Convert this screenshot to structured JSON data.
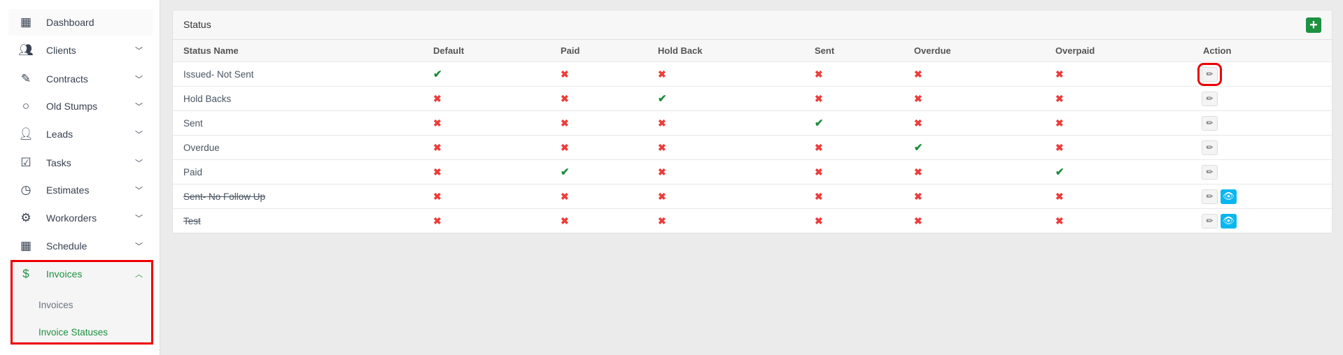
{
  "sidebar": {
    "items": [
      {
        "label": "Dashboard",
        "icon": "grid-icon",
        "chev": false
      },
      {
        "label": "Clients",
        "icon": "users-icon",
        "chev": true
      },
      {
        "label": "Contracts",
        "icon": "pen-icon",
        "chev": true
      },
      {
        "label": "Old Stumps",
        "icon": "circle-icon",
        "chev": true
      },
      {
        "label": "Leads",
        "icon": "user-plus-icon",
        "chev": true
      },
      {
        "label": "Tasks",
        "icon": "checkbox-icon",
        "chev": true
      },
      {
        "label": "Estimates",
        "icon": "clock-icon",
        "chev": true
      },
      {
        "label": "Workorders",
        "icon": "gear-icon",
        "chev": true
      },
      {
        "label": "Schedule",
        "icon": "calendar-icon",
        "chev": true
      },
      {
        "label": "Invoices",
        "icon": "dollar-icon",
        "chev": true
      }
    ],
    "sub_items": [
      "Invoices",
      "Invoice Statuses"
    ]
  },
  "card": {
    "title": "Status",
    "columns": [
      "Status Name",
      "Default",
      "Paid",
      "Hold Back",
      "Sent",
      "Overdue",
      "Overpaid",
      "Action"
    ],
    "rows": [
      {
        "name": "Issued- Not Sent",
        "flags": [
          1,
          0,
          0,
          0,
          0,
          0
        ],
        "deleted": false,
        "eye": false
      },
      {
        "name": "Hold Backs",
        "flags": [
          0,
          0,
          1,
          0,
          0,
          0
        ],
        "deleted": false,
        "eye": false
      },
      {
        "name": "Sent",
        "flags": [
          0,
          0,
          0,
          1,
          0,
          0
        ],
        "deleted": false,
        "eye": false
      },
      {
        "name": "Overdue",
        "flags": [
          0,
          0,
          0,
          0,
          1,
          0
        ],
        "deleted": false,
        "eye": false
      },
      {
        "name": "Paid",
        "flags": [
          0,
          1,
          0,
          0,
          0,
          1
        ],
        "deleted": false,
        "eye": false
      },
      {
        "name": "Sent- No Follow Up",
        "flags": [
          0,
          0,
          0,
          0,
          0,
          0
        ],
        "deleted": true,
        "eye": true
      },
      {
        "name": "Test",
        "flags": [
          0,
          0,
          0,
          0,
          0,
          0
        ],
        "deleted": true,
        "eye": true
      }
    ]
  },
  "colors": {
    "accent": "#1e9141",
    "check": "#1e8c3a",
    "cross": "#ee3b3b",
    "view": "#0bb6ef",
    "highlight": "#ee0000"
  }
}
